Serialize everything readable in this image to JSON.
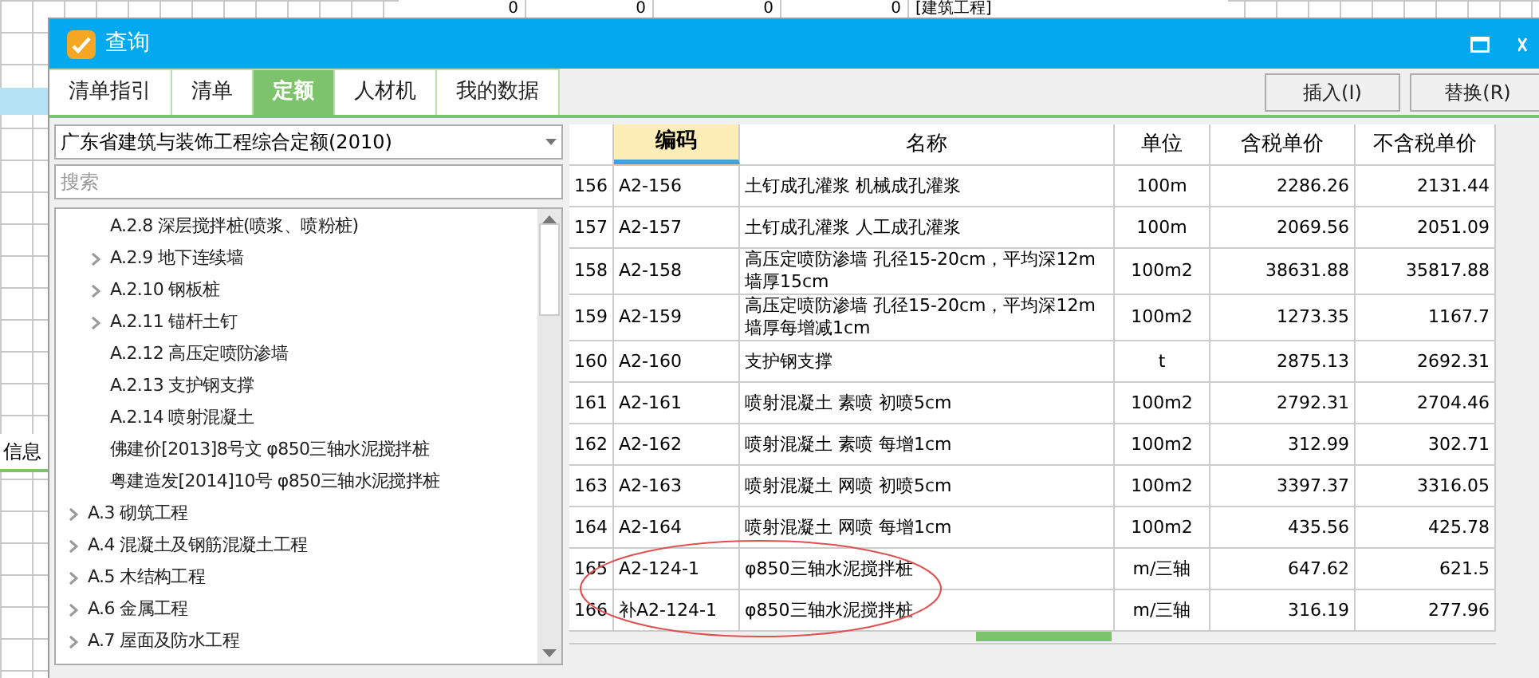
{
  "background_sheet": {
    "top_cells": [
      "0",
      "0",
      "0",
      "0"
    ],
    "top_label": "[建筑工程]",
    "side_tab": "信息"
  },
  "window": {
    "title": "查询"
  },
  "tabs": [
    {
      "label": "清单指引",
      "selected": false
    },
    {
      "label": "清单",
      "selected": false
    },
    {
      "label": "定额",
      "selected": true
    },
    {
      "label": "人材机",
      "selected": false
    },
    {
      "label": "我的数据",
      "selected": false
    }
  ],
  "buttons": [
    "插入(I)",
    "替换(R)"
  ],
  "library_select": {
    "value": "广东省建筑与装饰工程综合定额(2010)"
  },
  "search": {
    "placeholder": "搜索"
  },
  "tree": [
    {
      "children": [
        {
          "label": "A.2.8 深层搅拌桩(喷浆、喷粉桩)",
          "has_children": false
        },
        {
          "label": "A.2.9 地下连续墙",
          "has_children": true
        },
        {
          "label": "A.2.10 钢板桩",
          "has_children": true
        },
        {
          "label": "A.2.11 锚杆土钉",
          "has_children": true
        },
        {
          "label": "A.2.12 高压定喷防渗墙",
          "has_children": false
        },
        {
          "label": "A.2.13 支护钢支撑",
          "has_children": false
        },
        {
          "label": "A.2.14 喷射混凝土",
          "has_children": false
        },
        {
          "label": "佛建价[2013]8号文 φ850三轴水泥搅拌桩",
          "has_children": false
        },
        {
          "label": "粤建造发[2014]10号 φ850三轴水泥搅拌桩",
          "has_children": false
        }
      ]
    },
    {
      "label": "A.3 砌筑工程",
      "has_children": true
    },
    {
      "label": "A.4 混凝土及钢筋混凝土工程",
      "has_children": true
    },
    {
      "label": "A.5 木结构工程",
      "has_children": true
    },
    {
      "label": "A.6 金属工程",
      "has_children": true
    },
    {
      "label": "A.7 屋面及防水工程",
      "has_children": true
    }
  ],
  "table": {
    "columns": [
      {
        "label": "编码",
        "selected": true
      },
      {
        "label": "名称",
        "selected": false
      },
      {
        "label": "单位",
        "selected": false
      },
      {
        "label": "含税单价",
        "selected": false
      },
      {
        "label": "不含税单价",
        "selected": false
      }
    ],
    "rows": [
      {
        "number": "156",
        "cells": [
          "A2-156",
          "土钉成孔灌浆 机械成孔灌浆",
          "100m",
          "2286.26",
          "2131.44"
        ]
      },
      {
        "number": "157",
        "cells": [
          "A2-157",
          "土钉成孔灌浆 人工成孔灌浆",
          "100m",
          "2069.56",
          "2051.09"
        ]
      },
      {
        "number": "158",
        "cells": [
          "A2-158",
          "高压定喷防渗墙 孔径15-20cm，平均深12m 墙厚15cm",
          "100m2",
          "38631.88",
          "35817.88"
        ]
      },
      {
        "number": "159",
        "cells": [
          "A2-159",
          "高压定喷防渗墙 孔径15-20cm，平均深12m 墙厚每增减1cm",
          "100m2",
          "1273.35",
          "1167.7"
        ]
      },
      {
        "number": "160",
        "cells": [
          "A2-160",
          "支护钢支撑",
          "t",
          "2875.13",
          "2692.31"
        ]
      },
      {
        "number": "161",
        "cells": [
          "A2-161",
          "喷射混凝土 素喷 初喷5cm",
          "100m2",
          "2792.31",
          "2704.46"
        ]
      },
      {
        "number": "162",
        "cells": [
          "A2-162",
          "喷射混凝土 素喷 每增1cm",
          "100m2",
          "312.99",
          "302.71"
        ]
      },
      {
        "number": "163",
        "cells": [
          "A2-163",
          "喷射混凝土 网喷 初喷5cm",
          "100m2",
          "3397.37",
          "3316.05"
        ]
      },
      {
        "number": "164",
        "cells": [
          "A2-164",
          "喷射混凝土 网喷 每增1cm",
          "100m2",
          "435.56",
          "425.78"
        ]
      },
      {
        "number": "165",
        "cells": [
          "A2-124-1",
          "φ850三轴水泥搅拌桩",
          "m/三轴",
          "647.62",
          "621.5"
        ]
      },
      {
        "number": "166",
        "cells": [
          "补A2-124-1",
          "φ850三轴水泥搅拌桩",
          "m/三轴",
          "316.19",
          "277.96"
        ]
      }
    ]
  }
}
